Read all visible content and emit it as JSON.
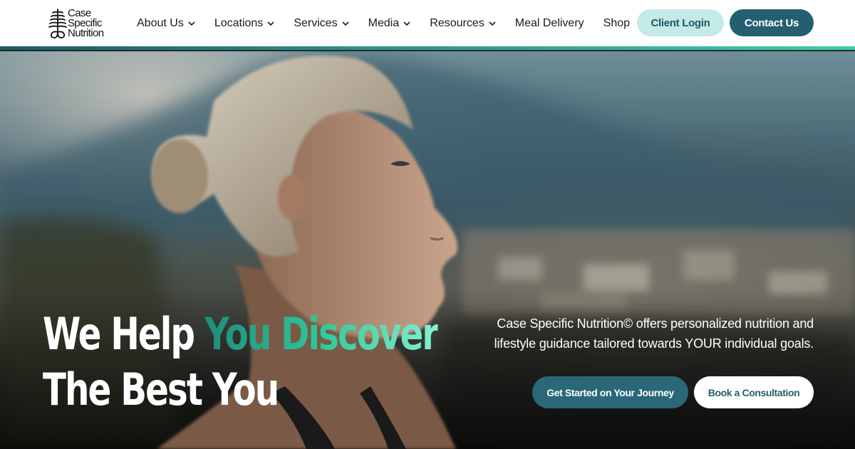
{
  "brand": {
    "logo_lines": [
      "Case",
      "Specific",
      "Nutrition"
    ],
    "logo_icon": "fern-leaf-icon"
  },
  "nav": {
    "items": [
      {
        "label": "About Us",
        "has_dropdown": true
      },
      {
        "label": "Locations",
        "has_dropdown": true
      },
      {
        "label": "Services",
        "has_dropdown": true
      },
      {
        "label": "Media",
        "has_dropdown": true
      },
      {
        "label": "Resources",
        "has_dropdown": true
      },
      {
        "label": "Meal Delivery",
        "has_dropdown": false
      },
      {
        "label": "Shop",
        "has_dropdown": false
      }
    ],
    "client_login_label": "Client Login",
    "contact_label": "Contact Us"
  },
  "hero": {
    "headline_part1": "We Help ",
    "headline_highlight": "You Discover",
    "headline_line2": "The Best You",
    "tagline": "Case Specific Nutrition© offers personalized nutrition and lifestyle guidance tailored towards YOUR individual goals.",
    "primary_cta": "Get Started on Your Journey",
    "secondary_cta": "Book a Consultation"
  },
  "colors": {
    "accent_dark": "#245f70",
    "accent_light": "#c4e9e6",
    "highlight_gradient_start": "#1f8a7c",
    "highlight_gradient_end": "#85f0cf"
  }
}
